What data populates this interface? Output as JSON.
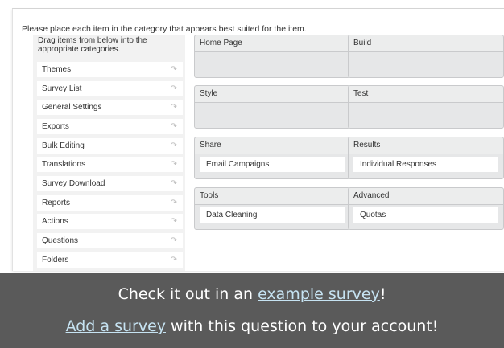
{
  "question": {
    "instructions": "Please place each item in the category that appears best suited for the item.",
    "source_hint": "Drag items from below into the appropriate categories."
  },
  "items": [
    {
      "label": "Themes"
    },
    {
      "label": "Survey List"
    },
    {
      "label": "General Settings"
    },
    {
      "label": "Exports"
    },
    {
      "label": "Bulk Editing"
    },
    {
      "label": "Translations"
    },
    {
      "label": "Survey Download"
    },
    {
      "label": "Reports"
    },
    {
      "label": "Actions"
    },
    {
      "label": "Questions"
    },
    {
      "label": "Folders"
    }
  ],
  "item_arrow_icon": "share-arrow-icon",
  "categories": [
    {
      "title": "Home Page",
      "items": []
    },
    {
      "title": "Build",
      "items": []
    },
    {
      "title": "Style",
      "items": []
    },
    {
      "title": "Test",
      "items": []
    },
    {
      "title": "Share",
      "items": [
        "Email Campaigns"
      ]
    },
    {
      "title": "Results",
      "items": [
        "Individual Responses"
      ]
    },
    {
      "title": "Tools",
      "items": [
        "Data Cleaning"
      ]
    },
    {
      "title": "Advanced",
      "items": [
        "Quotas"
      ]
    }
  ],
  "banner": {
    "line1_prefix": "Check it out in an ",
    "line1_link": "example survey",
    "line1_suffix": "!",
    "line2_link": "Add a survey",
    "line2_suffix": " with this question to your account!"
  },
  "colors": {
    "banner_bg": "#5a5a5a",
    "link": "#c6e3f2",
    "category_bg": "#e6e7e8"
  }
}
